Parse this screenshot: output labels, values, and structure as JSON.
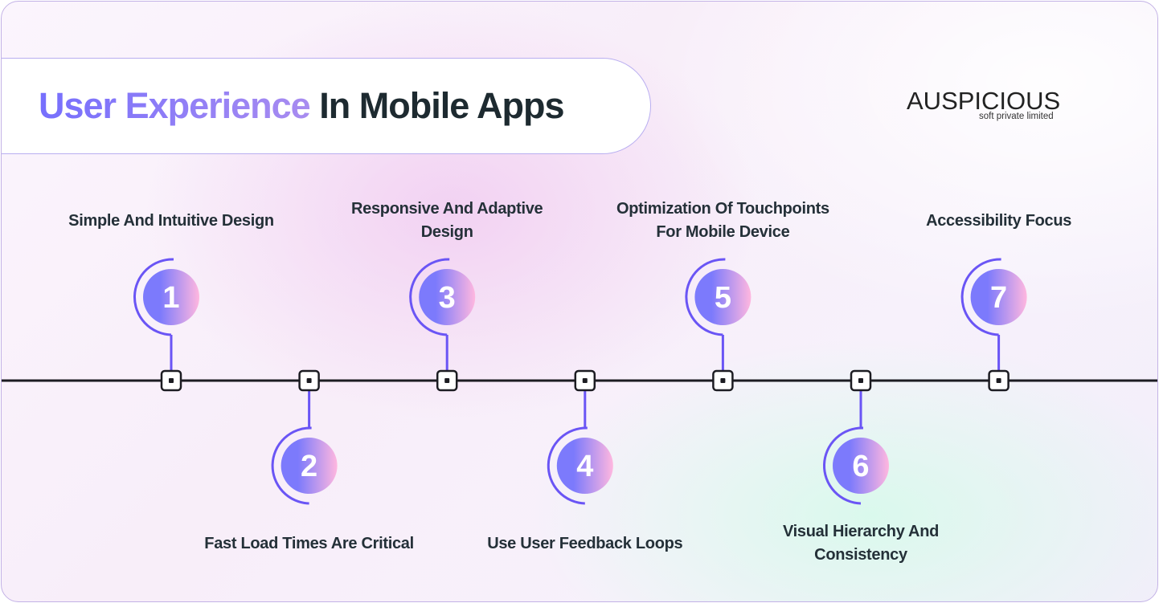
{
  "title": {
    "highlight": "User Experience",
    "rest": "In Mobile Apps"
  },
  "logo": {
    "name": "AUSPICIOUS",
    "tagline": "soft private limited"
  },
  "colors": {
    "accent": "#6a55f5",
    "circle_start": "#7c7afc",
    "circle_end": "#ffb7df",
    "timeline": "#1c1c22"
  },
  "steps": [
    {
      "num": "1",
      "label": "Simple And Intuitive Design",
      "position": "top"
    },
    {
      "num": "2",
      "label": "Fast Load Times Are Critical",
      "position": "bottom"
    },
    {
      "num": "3",
      "label": "Responsive And Adaptive Design",
      "position": "top"
    },
    {
      "num": "4",
      "label": "Use User Feedback Loops",
      "position": "bottom"
    },
    {
      "num": "5",
      "label": "Optimization Of Touchpoints For Mobile Device",
      "position": "top"
    },
    {
      "num": "6",
      "label": "Visual Hierarchy And Consistency",
      "position": "bottom"
    },
    {
      "num": "7",
      "label": "Accessibility Focus",
      "position": "top"
    }
  ]
}
